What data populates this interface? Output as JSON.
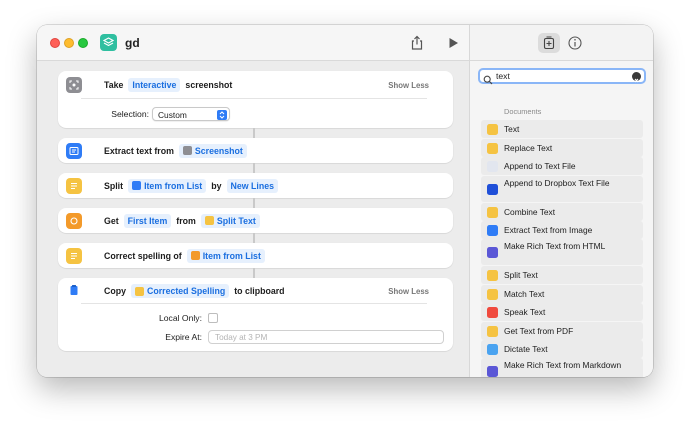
{
  "window": {
    "title": "gd"
  },
  "actions": {
    "a1": {
      "verb": "Take",
      "token": "Interactive",
      "after": "screenshot",
      "show_less": "Show Less",
      "selection_label": "Selection:",
      "selection_value": "Custom"
    },
    "a2": {
      "verb": "Extract text from",
      "token": "Screenshot"
    },
    "a3": {
      "verb": "Split",
      "token1": "Item from List",
      "mid": "by",
      "token2": "New Lines"
    },
    "a4": {
      "verb": "Get",
      "token1": "First Item",
      "mid": "from",
      "token2": "Split Text"
    },
    "a5": {
      "verb": "Correct spelling of",
      "token": "Item from List"
    },
    "a6": {
      "verb": "Copy",
      "token": "Corrected Spelling",
      "after": "to clipboard",
      "show_less": "Show Less",
      "local_only_label": "Local Only:",
      "expire_label": "Expire At:",
      "expire_placeholder": "Today at 3 PM"
    }
  },
  "sidebar": {
    "search_value": "text",
    "category": "Documents",
    "items": [
      {
        "label": "Text",
        "color": "#f5c342"
      },
      {
        "label": "Replace Text",
        "color": "#f5c342"
      },
      {
        "label": "Append to Text File",
        "color": "#e2e6ef"
      },
      {
        "label": "Append to Dropbox Text File",
        "color": "#1f4fd8"
      },
      {
        "label": "Combine Text",
        "color": "#f5c342"
      },
      {
        "label": "Extract Text from Image",
        "color": "#2f7cf6"
      },
      {
        "label": "Make Rich Text from HTML",
        "color": "#5b57d6"
      },
      {
        "label": "Split Text",
        "color": "#f5c342"
      },
      {
        "label": "Match Text",
        "color": "#f5c342"
      },
      {
        "label": "Speak Text",
        "color": "#f04a3e"
      },
      {
        "label": "Get Text from PDF",
        "color": "#f5c342"
      },
      {
        "label": "Dictate Text",
        "color": "#4aa3f0"
      },
      {
        "label": "Make Rich Text from Markdown",
        "color": "#5b57d6"
      }
    ]
  },
  "colors": {
    "accent": "#2f7cf6",
    "token_bg": "#e6f0fd",
    "token_text": "#1b6fe0"
  }
}
